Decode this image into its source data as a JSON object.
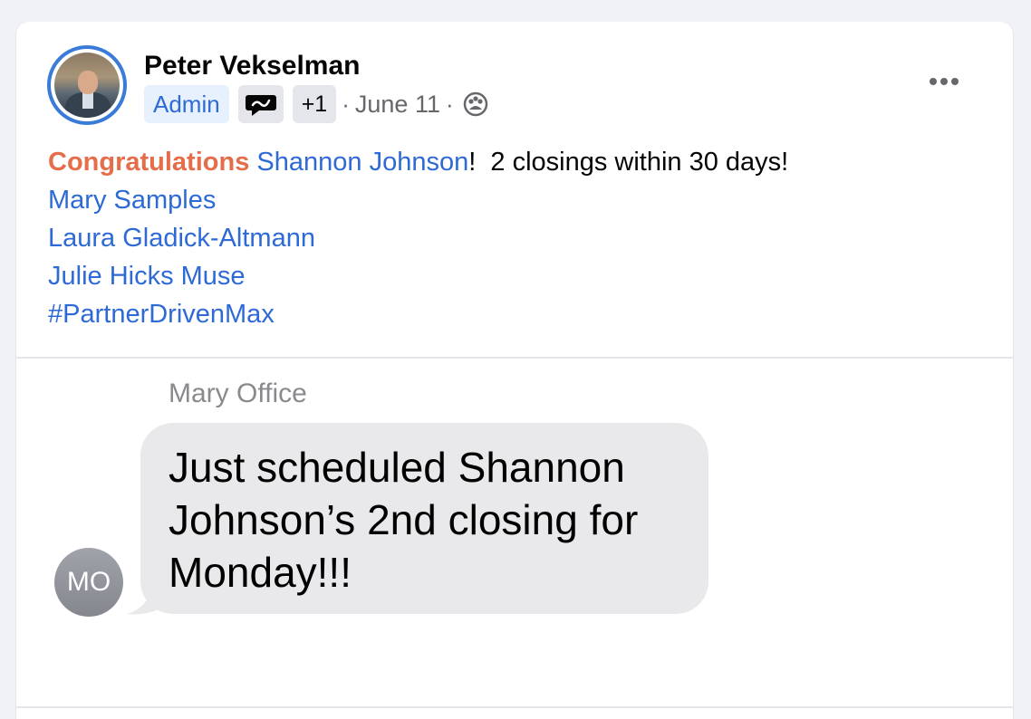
{
  "post": {
    "author": "Peter Vekselman",
    "badge_admin": "Admin",
    "badge_extra": "+1",
    "separator": "·",
    "date": "June 11",
    "icons": {
      "role_badge": "chat-bubble-badge-icon",
      "privacy": "group-privacy-icon",
      "more": "more-options-icon"
    },
    "text": {
      "congrats": "Congratulations",
      "mention_1": "Shannon Johnson",
      "after_mention": "!  2 closings within 30 days!",
      "mention_2": "Mary Samples",
      "mention_3": "Laura Gladick-Altmann",
      "mention_4": "Julie Hicks Muse",
      "hashtag": "#PartnerDrivenMax"
    }
  },
  "image": {
    "sender_name": "Mary Office",
    "avatar_initials": "MO",
    "message": "Just scheduled Shannon\nJohnson’s 2nd closing for\nMonday!!!"
  },
  "colors": {
    "accent_blue": "#2d6ad6",
    "congrats_orange": "#e56d4a",
    "avatar_ring": "#3a7ad9",
    "bubble_gray": "#e9e9eb"
  }
}
